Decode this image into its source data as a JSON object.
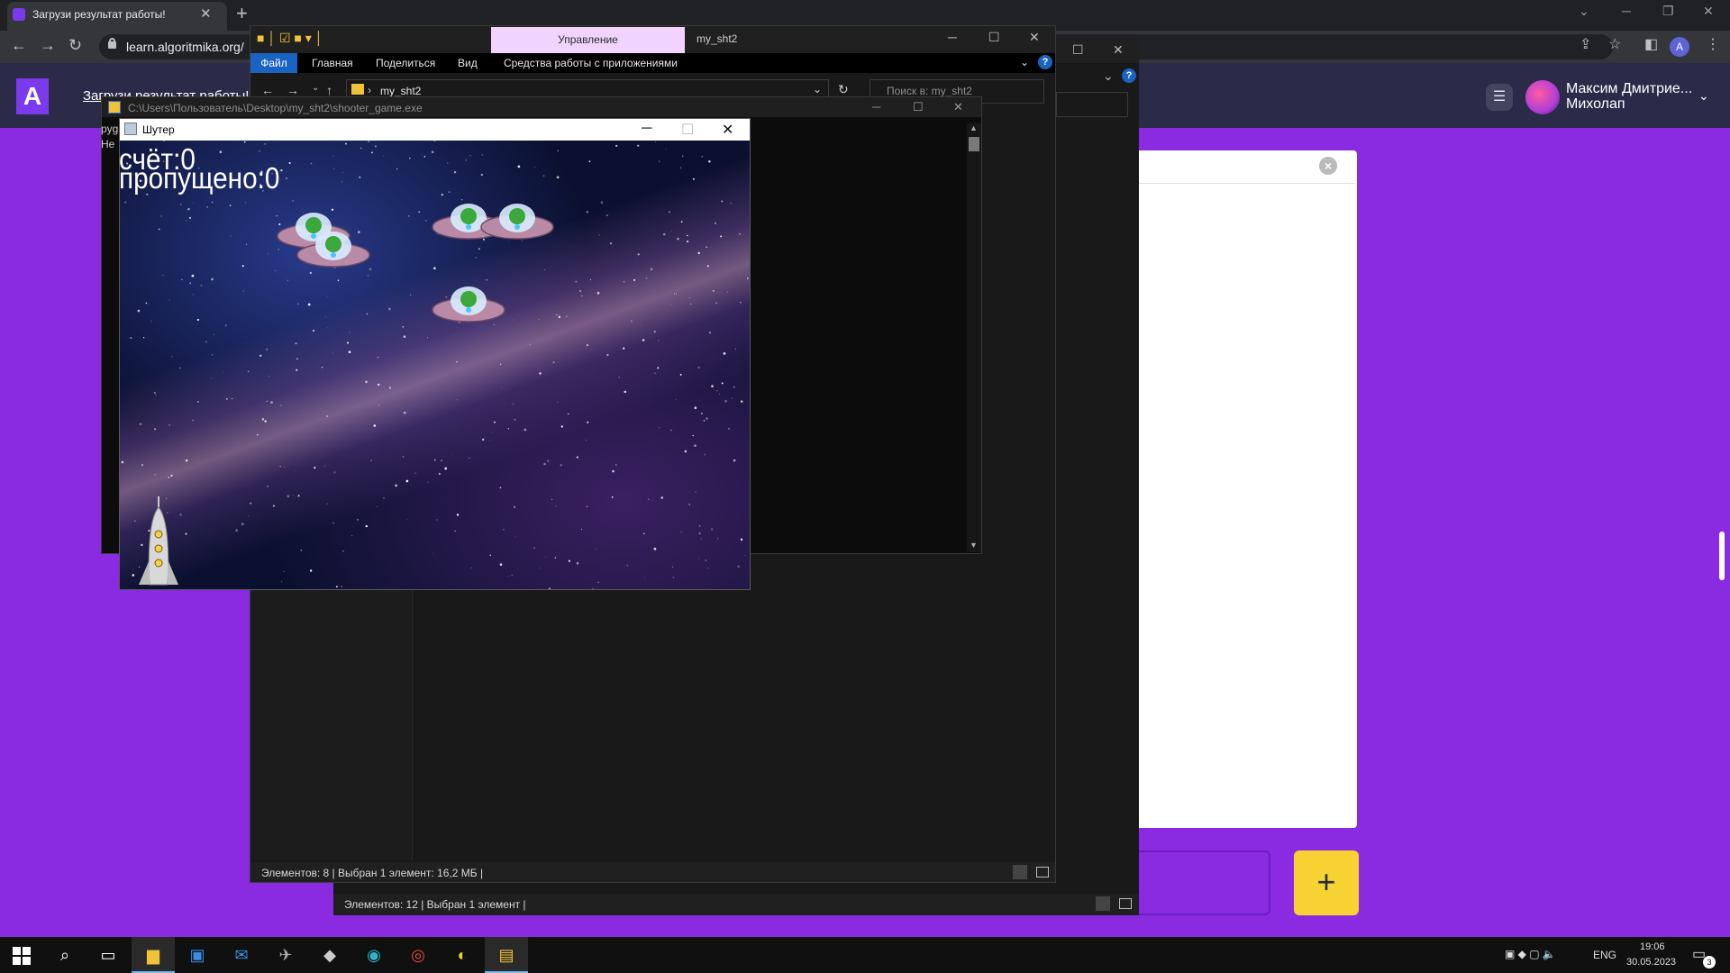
{
  "browser": {
    "tab_title": "Загрузи результат работы!",
    "url": "learn.algoritmika.org/",
    "profile_initial": "A"
  },
  "site": {
    "logo_letter": "A",
    "heading": "Загрузи результат работы!",
    "user_first": "Максим Дмитрие...",
    "user_last": "Михолап",
    "add_label": "+",
    "close_label": "×",
    "colors": {
      "background": "#8a2be2",
      "accent": "#f6d232"
    }
  },
  "explorer_front": {
    "manage_tab": "Управление",
    "folder_name": "my_sht2",
    "ribbon": [
      "Файл",
      "Главная",
      "Поделиться",
      "Вид",
      "Средства работы с приложениями"
    ],
    "address": "my_sht2",
    "search_placeholder": "Поиск в: my_sht2",
    "status": "Элементов: 8   |   Выбран 1 элемент: 16,2 МБ   |"
  },
  "explorer_back": {
    "status": "Элементов: 12   |   Выбран 1 элемент   |"
  },
  "console": {
    "path": "C:\\Users\\Пользователь\\Desktop\\my_sht2\\shooter_game.exe",
    "line1": "pyg",
    "line2": "He"
  },
  "game": {
    "title": "Шутер",
    "score": "счёт:0",
    "missed": "пропущено:0",
    "ufo_count_visible": 5
  },
  "taskbar": {
    "lang": "ENG",
    "time": "19:06",
    "date": "30.05.2023",
    "notifications": "3",
    "apps": [
      "search-icon",
      "task-view-icon",
      "file-explorer-icon",
      "store-icon",
      "mail-icon",
      "app-icon",
      "app-icon",
      "edge-icon",
      "chrome-icon",
      "app-icon",
      "python-icon"
    ]
  }
}
